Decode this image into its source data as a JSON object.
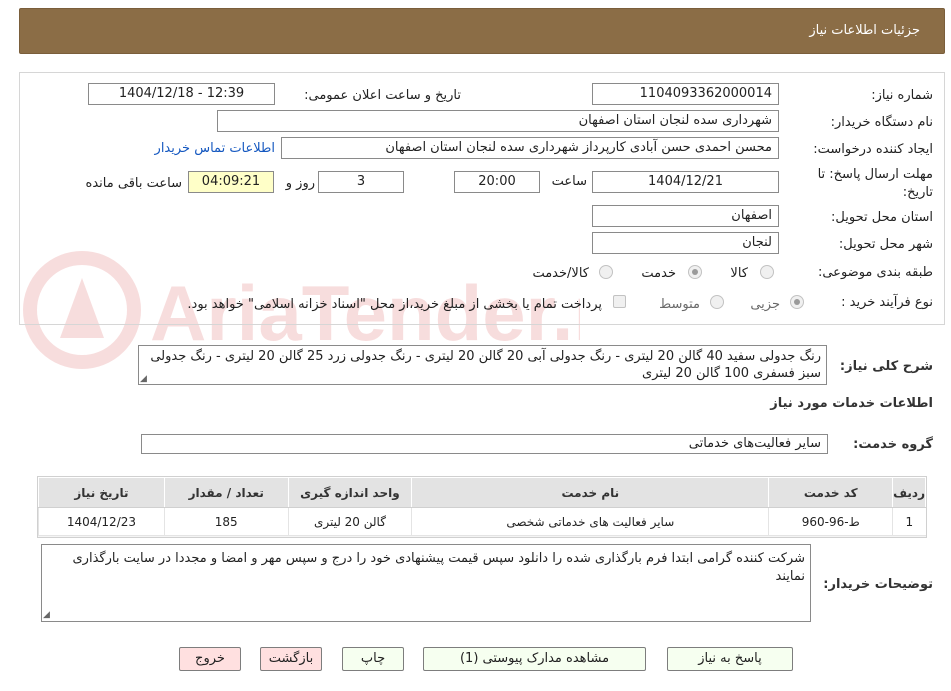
{
  "header": {
    "title": "جزئیات اطلاعات نیاز"
  },
  "form": {
    "need_number_label": "شماره نیاز:",
    "need_number": "1104093362000014",
    "announce_label": "تاریخ و ساعت اعلان عمومی:",
    "announce_value": "1404/12/18 - 12:39",
    "buyer_org_label": "نام دستگاه خریدار:",
    "buyer_org": "شهرداری سده لنجان استان اصفهان",
    "creator_label": "ایجاد کننده درخواست:",
    "creator": "محسن احمدی حسن آبادی کارپرداز شهرداری سده لنجان استان اصفهان",
    "contact_link": "اطلاعات تماس خریدار",
    "deadline_label_1": "مهلت ارسال پاسخ: تا",
    "deadline_label_2": "تاریخ:",
    "deadline_date": "1404/12/21",
    "time_label": "ساعت",
    "deadline_time": "20:00",
    "days_value": "3",
    "days_label": "روز و",
    "remaining_time": "04:09:21",
    "remaining_label": "ساعت باقی مانده",
    "province_label": "استان محل تحویل:",
    "province": "اصفهان",
    "city_label": "شهر محل تحویل:",
    "city": "لنجان",
    "category_label": "طبقه بندی موضوعی:",
    "category_options": [
      "کالا",
      "خدمت",
      "کالا/خدمت"
    ],
    "category_selected": 1,
    "process_label": "نوع فرآیند خرید :",
    "process_options": [
      "جزیی",
      "متوسط"
    ],
    "process_selected": 0,
    "payment_note": "پرداخت تمام یا بخشی از مبلغ خرید،از محل \"اسناد خزانه اسلامی\" خواهد بود."
  },
  "description": {
    "label": "شرح کلی نیاز:",
    "text": "رنگ جدولی سفید 40 گالن 20 لیتری - رنگ جدولی آبی 20 گالن 20 لیتری - رنگ جدولی زرد 25 گالن 20 لیتری - رنگ جدولی سبز فسفری 100 گالن 20 لیتری"
  },
  "services_section": {
    "title": "اطلاعات خدمات مورد نیاز",
    "group_label": "گروه خدمت:",
    "group_value": "سایر فعالیت‌های خدماتی"
  },
  "table": {
    "headers": [
      "ردیف",
      "کد خدمت",
      "نام خدمت",
      "واحد اندازه گیری",
      "تعداد / مقدار",
      "تاریخ نیاز"
    ],
    "rows": [
      [
        "1",
        "ط-96-960",
        "سایر فعالیت های خدماتی شخصی",
        "گالن 20 لیتری",
        "185",
        "1404/12/23"
      ]
    ]
  },
  "buyer_notes": {
    "label": "توضیحات خریدار:",
    "text": "شرکت کننده گرامی ابتدا فرم بارگذاری شده را دانلود سپس قیمت پیشنهادی خود را درج و سپس مهر و امضا و مجددا در سایت بارگذاری نمایند"
  },
  "buttons": {
    "reply": "پاسخ به نیاز",
    "attachments": "مشاهده مدارک پیوستی (1)",
    "print": "چاپ",
    "back": "بازگشت",
    "exit": "خروج"
  },
  "watermark": {
    "text": "AriaTender.neT"
  },
  "colors": {
    "header_bg": "#8b6d46",
    "link": "#1558c0",
    "remaining_bg": "#ffffc8"
  }
}
